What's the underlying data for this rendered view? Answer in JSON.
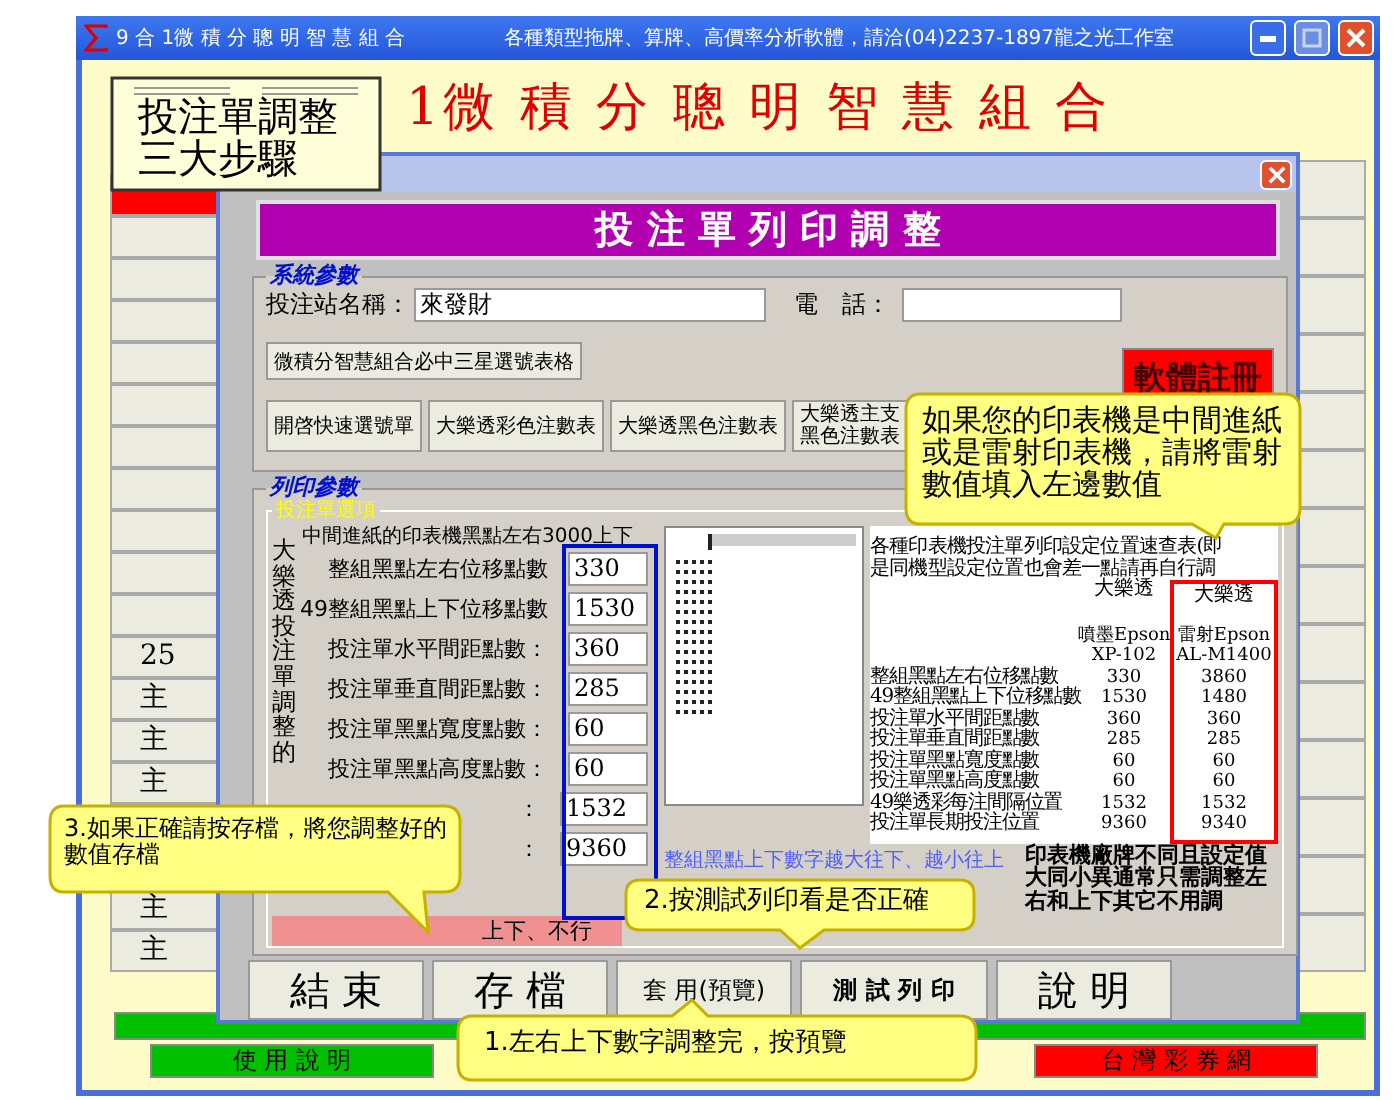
{
  "main_window": {
    "title": "9 合 1微 積 分 聰 明 智 慧 組 合",
    "subtitle": "各種類型拖牌、算牌、高價率分析軟體，請洽(04)2237-1897龍之光工作室",
    "heading": "1微 積 分 聰 明 智 慧 組 合",
    "left_buttons": [
      "25",
      "主",
      "主",
      "主",
      "主",
      "主"
    ],
    "bottom_buttons": [
      {
        "label": "使 用 說 明",
        "color": "#00c000"
      },
      {
        "label": "台 灣 彩 券 網",
        "color": "#ff0000"
      }
    ]
  },
  "dialog": {
    "banner": "投 注 單 列 印 調 整",
    "system_group": {
      "title": "系統參數",
      "station_label": "投注站名稱：",
      "station_value": "來發財",
      "phone_label": "電　話：",
      "table_button": "微積分智慧組合必中三星選號表格",
      "register_button": "軟體註冊",
      "sheet_buttons": [
        "開啓快速選號單",
        "大樂透彩色注數表",
        "大樂透黑色注數表",
        "大樂透主支黑色注數表"
      ]
    },
    "print_group": {
      "title": "列印參數",
      "subtitle": "投注單選項",
      "side_label": "大樂透投注單調整的",
      "note": "中間進紙的印表機黑點左右3000上下",
      "fields": [
        {
          "label": "整組黑點左右位移點數",
          "value": "330"
        },
        {
          "label": "49整組黑點上下位移點數",
          "value": "1530"
        },
        {
          "label": "投注單水平間距點數：",
          "value": "360"
        },
        {
          "label": "投注單垂直間距點數：",
          "value": "285"
        },
        {
          "label": "投注單黑點寬度點數：",
          "value": "60"
        },
        {
          "label": "投注單黑點高度點數：",
          "value": "60"
        },
        {
          "label": "：",
          "value": "1532"
        },
        {
          "label": "：",
          "value": "9360"
        }
      ],
      "hint": "整組黑點上下數字越大往下、越小往上",
      "warning": "上下、不行",
      "reference": {
        "heading_lines": [
          "各種印表機投注單列印設定位置速查表(即",
          "是同機型設定位置也會差一點請再自行調"
        ],
        "columns": [
          {
            "game": "大樂透",
            "printer": "噴墨Epson",
            "model": "XP-102"
          },
          {
            "game": "大樂透",
            "printer": "雷射Epson",
            "model": "AL-M1400"
          }
        ],
        "rows": [
          {
            "label": "整組黑點左右位移點數",
            "values": [
              "330",
              "3860"
            ]
          },
          {
            "label": "49整組黑點上下位移點數",
            "values": [
              "1530",
              "1480"
            ]
          },
          {
            "label": "投注單水平間距點數",
            "values": [
              "360",
              "360"
            ]
          },
          {
            "label": "投注單垂直間距點數",
            "values": [
              "285",
              "285"
            ]
          },
          {
            "label": "投注單黑點寬度點數",
            "values": [
              "60",
              "60"
            ]
          },
          {
            "label": "投注單黑點高度點數",
            "values": [
              "60",
              "60"
            ]
          },
          {
            "label": "49樂透彩每注間隔位置",
            "values": [
              "1532",
              "1532"
            ]
          },
          {
            "label": "投注單長期投注位置",
            "values": [
              "9360",
              "9340"
            ]
          }
        ],
        "note": "印表機廠牌不同且設定值大同小異通常只需調整左右和上下其它不用調"
      }
    },
    "buttons": [
      {
        "label": "結 束",
        "kind": "large"
      },
      {
        "label": "存 檔",
        "kind": "large"
      },
      {
        "label": "套 用(預覽)",
        "kind": "small"
      },
      {
        "label": "測 試 列 印",
        "kind": "bold"
      },
      {
        "label": "說 明",
        "kind": "large"
      }
    ]
  },
  "callouts": [
    {
      "text": "投注單調整三大步驟",
      "kind": "note"
    },
    {
      "text": "如果您的印表機是中間進紙或是雷射印表機，請將雷射數值填入左邊數值",
      "kind": "bubble"
    },
    {
      "text": "3.如果正確請按存檔，將您調整好的數值存檔",
      "kind": "bubble"
    },
    {
      "text": "2.按測試列印看是否正確",
      "kind": "bubble"
    },
    {
      "text": "1.左右上下數字調整完，按預覽",
      "kind": "bubble"
    }
  ]
}
